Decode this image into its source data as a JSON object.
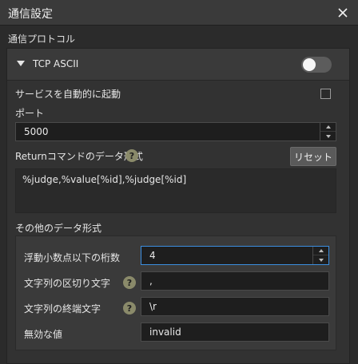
{
  "window": {
    "title": "通信設定",
    "close_icon": "close-icon"
  },
  "protocol_section": {
    "label": "通信プロトコル",
    "protocol_name": "TCP ASCII",
    "enabled": false
  },
  "auto_start": {
    "label": "サービスを自動的に起動",
    "checked": false
  },
  "port": {
    "label": "ポート",
    "value": "5000"
  },
  "return_command": {
    "label": "Returnコマンドのデータ形式",
    "help": "?",
    "reset_label": "リセット",
    "format": "%judge,%value[%id],%judge[%id]"
  },
  "other_format": {
    "label": "その他のデータ形式",
    "decimal_digits_label": "浮動小数点以下の桁数",
    "decimal_digits_value": "4",
    "delimiter_label": "文字列の区切り文字",
    "delimiter_help": "?",
    "delimiter_value": ",",
    "terminator_label": "文字列の終端文字",
    "terminator_help": "?",
    "terminator_value": "\\r",
    "invalid_label": "無効な値",
    "invalid_value": "invalid"
  },
  "colors": {
    "background": "#2b2b2b",
    "focus": "#3b8ee0",
    "help_badge": "#8a8a6a"
  }
}
